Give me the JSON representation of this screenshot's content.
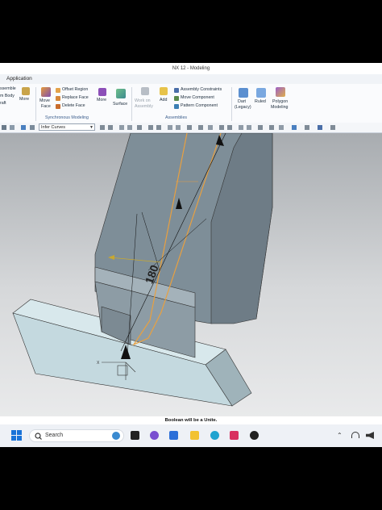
{
  "window": {
    "title": "NX 12 - Modeling"
  },
  "menu": {
    "application": "Application"
  },
  "ribbon": {
    "left_edge": {
      "line1": "ssemble",
      "line2": "m Body",
      "line3": "raft"
    },
    "more1": "More",
    "move_face": {
      "line1": "Move",
      "line2": "Face"
    },
    "sync_small": [
      "Offset Region",
      "Replace Face",
      "Delete Face"
    ],
    "more2": "More",
    "surface": "Surface",
    "sync_group": "Synchronous Modeling",
    "work_on_assembly": {
      "line1": "Work on",
      "line2": "Assembly"
    },
    "add": "Add",
    "asm_small": [
      "Assembly Constraints",
      "Move Component",
      "Pattern Component"
    ],
    "asm_group": "Assemblies",
    "dart": {
      "line1": "Dart",
      "line2": "(Legacy)"
    },
    "ruled": "Ruled",
    "polygon": {
      "line1": "Polygon",
      "line2": "Modeling"
    }
  },
  "toolbar": {
    "snap_combo": "Infer Curves"
  },
  "status": {
    "message": "Boolean will be a Unite."
  },
  "taskbar": {
    "search_placeholder": "Search"
  },
  "colors": {
    "accent": "#3a5d8c",
    "model_top": "#7e8e98",
    "model_front": "#9aa8b0",
    "base_block": "#c8dde3",
    "sketch_curve": "#e8a040"
  }
}
